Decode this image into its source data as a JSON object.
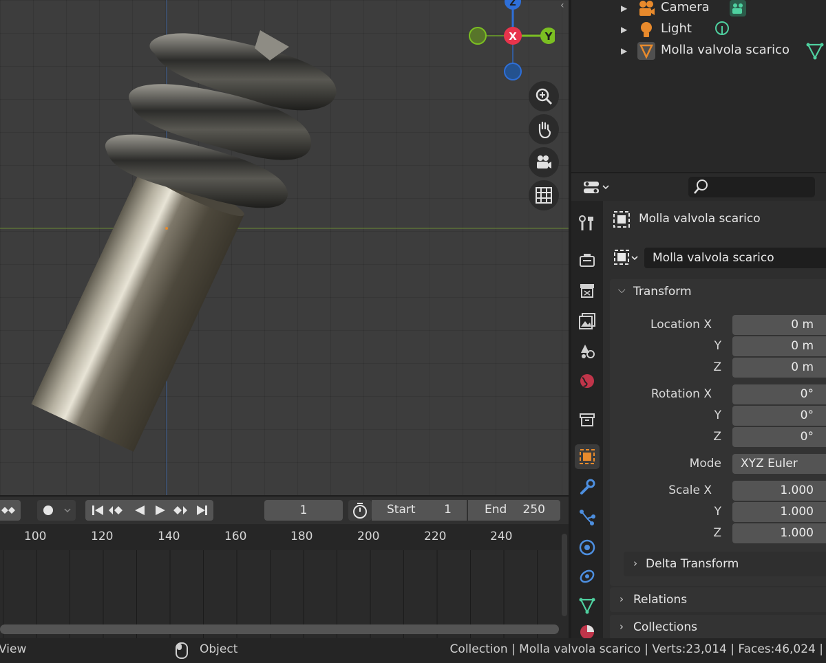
{
  "outliner": {
    "items": [
      {
        "label": "Camera",
        "icon": "camera-icon"
      },
      {
        "label": "Light",
        "icon": "light-icon"
      },
      {
        "label": "Molla valvola scarico",
        "icon": "mesh-object-icon"
      }
    ]
  },
  "gizmo": {
    "x": "X",
    "y": "Y",
    "z": "Z"
  },
  "properties": {
    "search_placeholder": "",
    "object_name": "Molla valvola scarico",
    "datablock_name": "Molla valvola scarico",
    "transform": {
      "title": "Transform",
      "location_label": "Location X",
      "y_label": "Y",
      "z_label": "Z",
      "location": [
        "0 m",
        "0 m",
        "0 m"
      ],
      "rotation_label": "Rotation X",
      "rotation": [
        "0°",
        "0°",
        "0°"
      ],
      "mode_label": "Mode",
      "mode_value": "XYZ Euler",
      "scale_label": "Scale X",
      "scale": [
        "1.000",
        "1.000",
        "1.000"
      ]
    },
    "delta_transform": "Delta Transform",
    "relations": "Relations",
    "collections": "Collections"
  },
  "timeline": {
    "current_frame": "1",
    "start_label": "Start",
    "start_value": "1",
    "end_label": "End",
    "end_value": "250",
    "ruler": [
      "100",
      "120",
      "140",
      "160",
      "180",
      "200",
      "220",
      "240"
    ]
  },
  "statusbar": {
    "left": "View",
    "mode": "Object",
    "info": "Collection | Molla valvola scarico | Verts:23,014 | Faces:46,024 |"
  },
  "colors": {
    "axis_x": "#e8344c",
    "axis_y": "#7bbf22",
    "axis_z": "#2e6fd8",
    "accent_orange": "#e88a2c"
  }
}
